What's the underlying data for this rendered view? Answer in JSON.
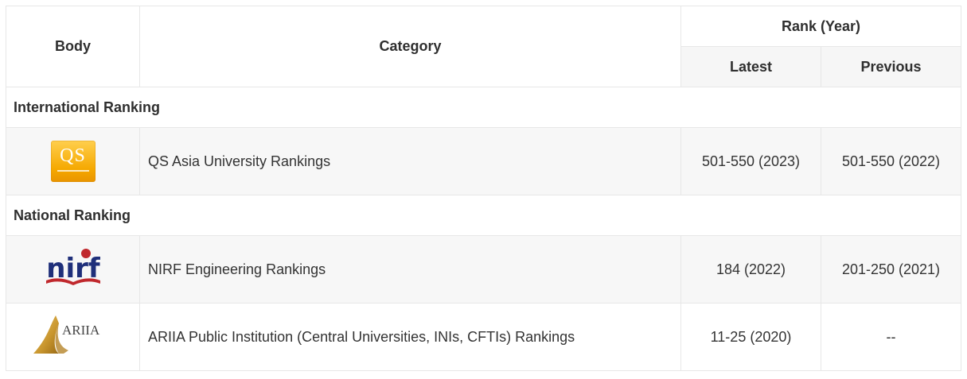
{
  "headers": {
    "body": "Body",
    "category": "Category",
    "rank_year": "Rank (Year)",
    "latest": "Latest",
    "previous": "Previous"
  },
  "sections": [
    {
      "title": "International Ranking",
      "rows": [
        {
          "logo": "qs-logo",
          "logo_text": "QS",
          "category": "QS Asia University Rankings",
          "latest": "501-550 (2023)",
          "previous": "501-550 (2022)"
        }
      ]
    },
    {
      "title": "National Ranking",
      "rows": [
        {
          "logo": "nirf-logo",
          "logo_text": "nirf",
          "category": "NIRF Engineering Rankings",
          "latest": "184 (2022)",
          "previous": "201-250 (2021)"
        },
        {
          "logo": "ariia-logo",
          "logo_text": "ARIIA",
          "category": "ARIIA Public Institution (Central Universities, INIs, CFTIs) Rankings",
          "latest": "11-25 (2020)",
          "previous": "--"
        }
      ]
    }
  ],
  "colors": {
    "border": "#e7e7e7",
    "shade": "#f7f7f7",
    "header_shade": "#f6f6f6",
    "qs_orange": "#f5a800",
    "nirf_blue": "#1f2f7a",
    "nirf_red": "#c0282d",
    "ariia_gold": "#c9962e"
  }
}
